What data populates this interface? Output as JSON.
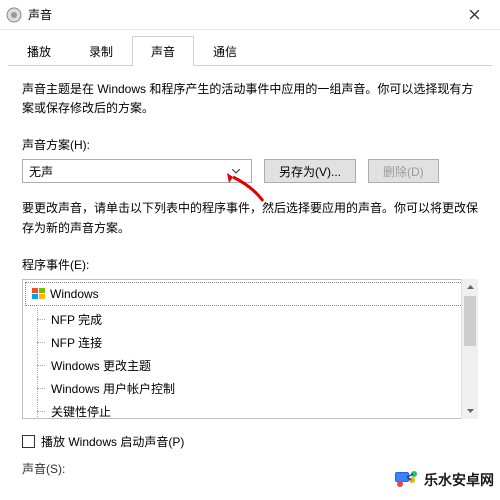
{
  "titlebar": {
    "title": "声音"
  },
  "tabs": {
    "playback": "播放",
    "recording": "录制",
    "sounds": "声音",
    "communication": "通信"
  },
  "description": "声音主题是在 Windows 和程序产生的活动事件中应用的一组声音。你可以选择现有方案或保存修改后的方案。",
  "schemeLabel": "声音方案(H):",
  "scheme": {
    "value": "无声"
  },
  "saveAs": "另存为(V)...",
  "delete": "删除(D)",
  "eventsDesc": "要更改声音，请单击以下列表中的程序事件，然后选择要应用的声音。你可以将更改保存为新的声音方案。",
  "eventsLabel": "程序事件(E):",
  "tree": {
    "root": "Windows",
    "items": [
      "NFP 完成",
      "NFP 连接",
      "Windows 更改主题",
      "Windows 用户帐户控制",
      "关键性停止"
    ]
  },
  "playStartup": "播放 Windows 启动声音(P)",
  "soundLabel": "声音(S):",
  "watermark": "乐水安卓网"
}
